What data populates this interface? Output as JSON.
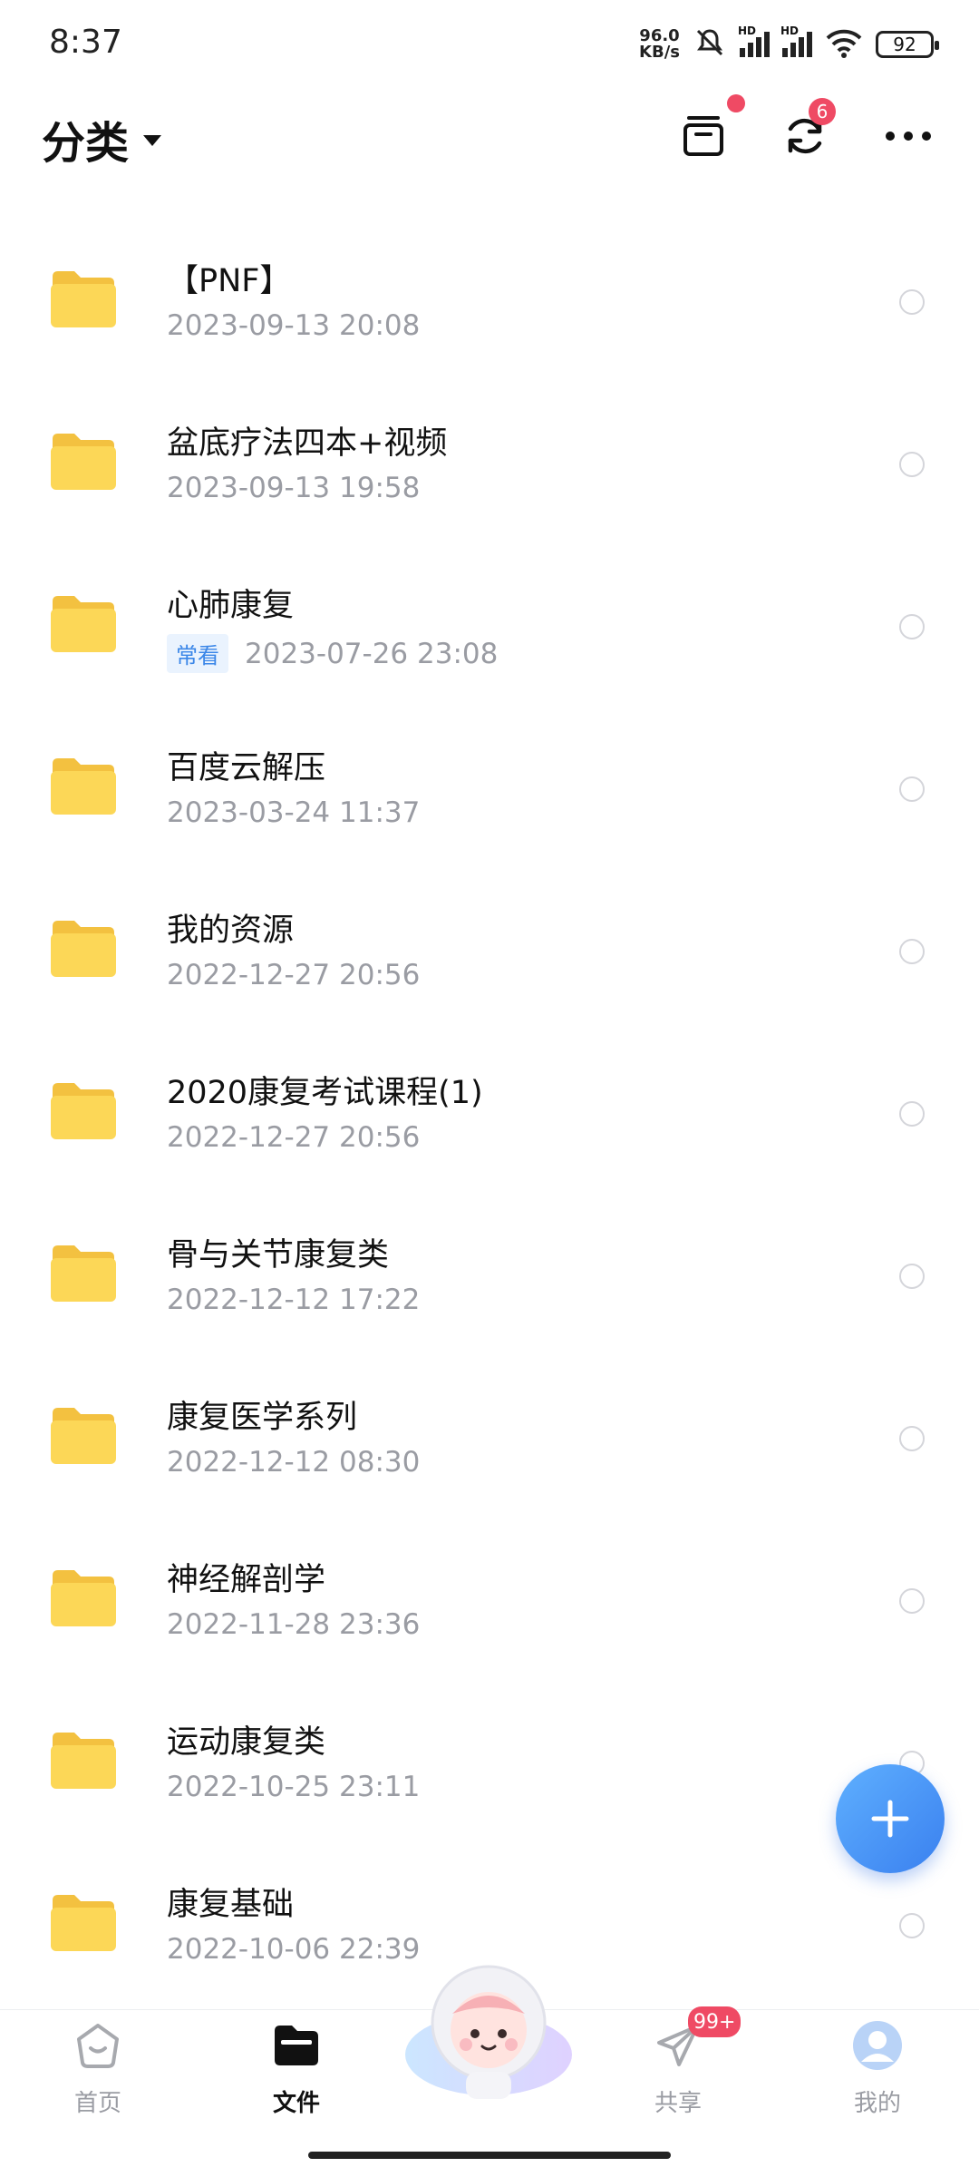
{
  "status": {
    "time": "8:37",
    "net_speed_value": "96.0",
    "net_speed_unit": "KB/s",
    "hd1": "HD",
    "hd2": "HD",
    "battery": "92"
  },
  "header": {
    "title": "分类",
    "sync_badge": "6"
  },
  "files": [
    {
      "name": "【PNF】",
      "date": "2023-09-13  20:08",
      "tag": ""
    },
    {
      "name": "盆底疗法四本+视频",
      "date": "2023-09-13  19:58",
      "tag": ""
    },
    {
      "name": "心肺康复",
      "date": "2023-07-26  23:08",
      "tag": "常看"
    },
    {
      "name": "百度云解压",
      "date": "2023-03-24  11:37",
      "tag": ""
    },
    {
      "name": "我的资源",
      "date": "2022-12-27  20:56",
      "tag": ""
    },
    {
      "name": "2020康复考试课程(1)",
      "date": "2022-12-27  20:56",
      "tag": ""
    },
    {
      "name": "骨与关节康复类",
      "date": "2022-12-12  17:22",
      "tag": ""
    },
    {
      "name": "康复医学系列",
      "date": "2022-12-12  08:30",
      "tag": ""
    },
    {
      "name": "神经解剖学",
      "date": "2022-11-28  23:36",
      "tag": ""
    },
    {
      "name": "运动康复类",
      "date": "2022-10-25  23:11",
      "tag": ""
    },
    {
      "name": "康复基础",
      "date": "2022-10-06  22:39",
      "tag": ""
    }
  ],
  "nav": {
    "home": "首页",
    "files": "文件",
    "share": "共享",
    "share_badge": "99+",
    "me": "我的"
  },
  "colors": {
    "accent": "#3a80ef",
    "badge": "#ef4a64",
    "folder": "#fcd757",
    "date": "#9a9ca3"
  }
}
